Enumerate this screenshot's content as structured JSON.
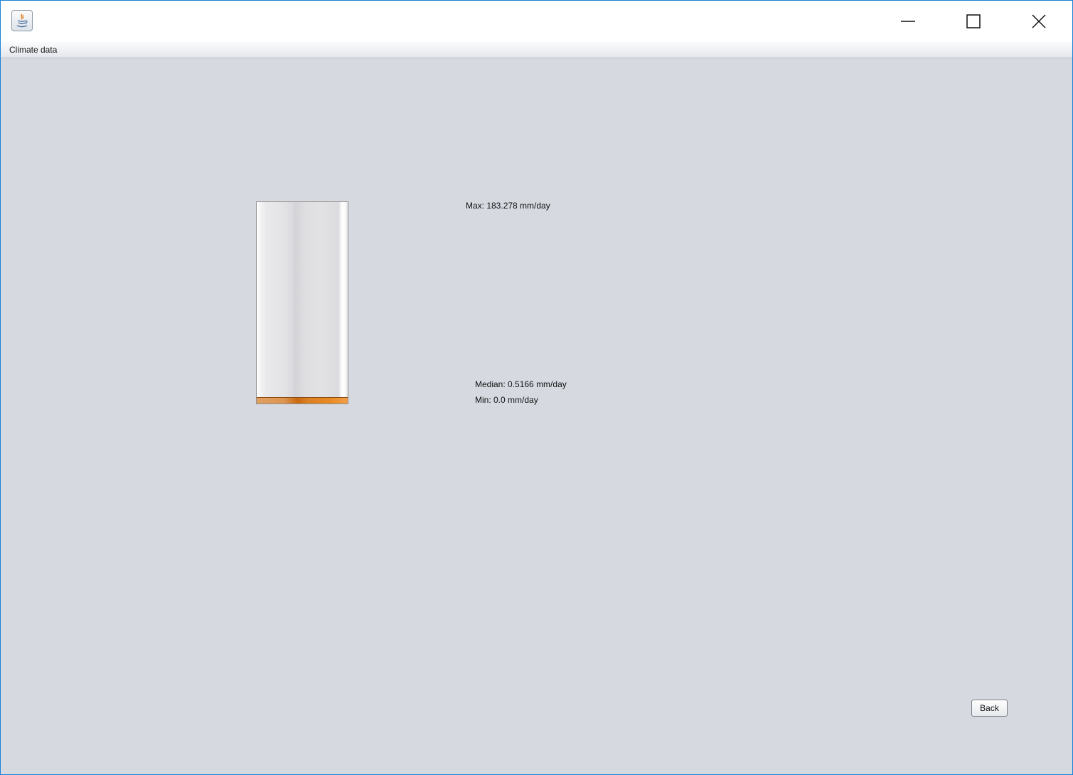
{
  "window": {
    "title": "",
    "accent": "#1883d7",
    "icon": "java-app-icon",
    "controls": {
      "minimize_icon": "minimize-icon",
      "maximize_icon": "maximize-icon",
      "close_icon": "close-icon"
    }
  },
  "menubar": {
    "items": [
      {
        "label": "Climate data"
      }
    ]
  },
  "gauge": {
    "max_label": "Max: 183.278 mm/day",
    "median_label": "Median: 0.5166 mm/day",
    "min_label": "Min: 0.0 mm/day",
    "max_value": 183.278,
    "median_value": 0.5166,
    "min_value": 0.0,
    "fill_fraction": 0.03,
    "fill_color": "#d97f26"
  },
  "actions": {
    "back_label": "Back"
  }
}
